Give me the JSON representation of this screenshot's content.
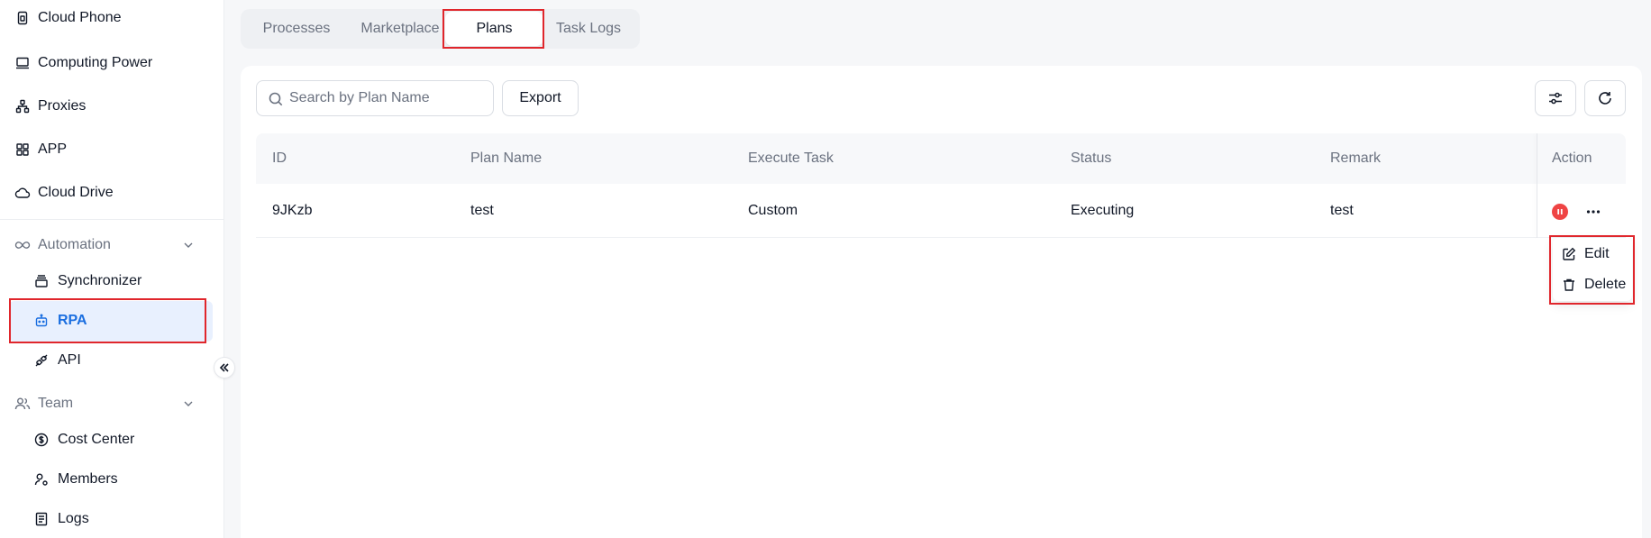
{
  "sidebar": {
    "items": [
      {
        "label": "Cloud Phone",
        "icon": "phone-icon"
      },
      {
        "label": "Computing Power",
        "icon": "monitor-icon"
      },
      {
        "label": "Proxies",
        "icon": "network-icon"
      },
      {
        "label": "APP",
        "icon": "grid-icon"
      },
      {
        "label": "Cloud Drive",
        "icon": "cloud-icon"
      }
    ],
    "automation": {
      "label": "Automation",
      "children": [
        {
          "label": "Synchronizer",
          "icon": "layers-icon"
        },
        {
          "label": "RPA",
          "icon": "robot-icon",
          "active": true
        },
        {
          "label": "API",
          "icon": "plug-icon"
        }
      ]
    },
    "team": {
      "label": "Team",
      "children": [
        {
          "label": "Cost Center",
          "icon": "dollar-icon"
        },
        {
          "label": "Members",
          "icon": "user-gear-icon"
        },
        {
          "label": "Logs",
          "icon": "document-icon"
        }
      ]
    },
    "active_color": "#1a6ee0"
  },
  "tabs": [
    {
      "label": "Processes"
    },
    {
      "label": "Marketplace"
    },
    {
      "label": "Plans",
      "active": true
    },
    {
      "label": "Task Logs"
    }
  ],
  "toolbar": {
    "search_placeholder": "Search by Plan Name",
    "export_label": "Export"
  },
  "table": {
    "columns": [
      "ID",
      "Plan Name",
      "Execute Task",
      "Status",
      "Remark",
      "Action"
    ],
    "rows": [
      {
        "id": "9JKzb",
        "plan_name": "test",
        "execute_task": "Custom",
        "status": "Executing",
        "remark": "test"
      }
    ]
  },
  "row_menu": {
    "edit_label": "Edit",
    "delete_label": "Delete"
  },
  "colors": {
    "highlight": "#e0262c",
    "pause": "#ef4444"
  }
}
